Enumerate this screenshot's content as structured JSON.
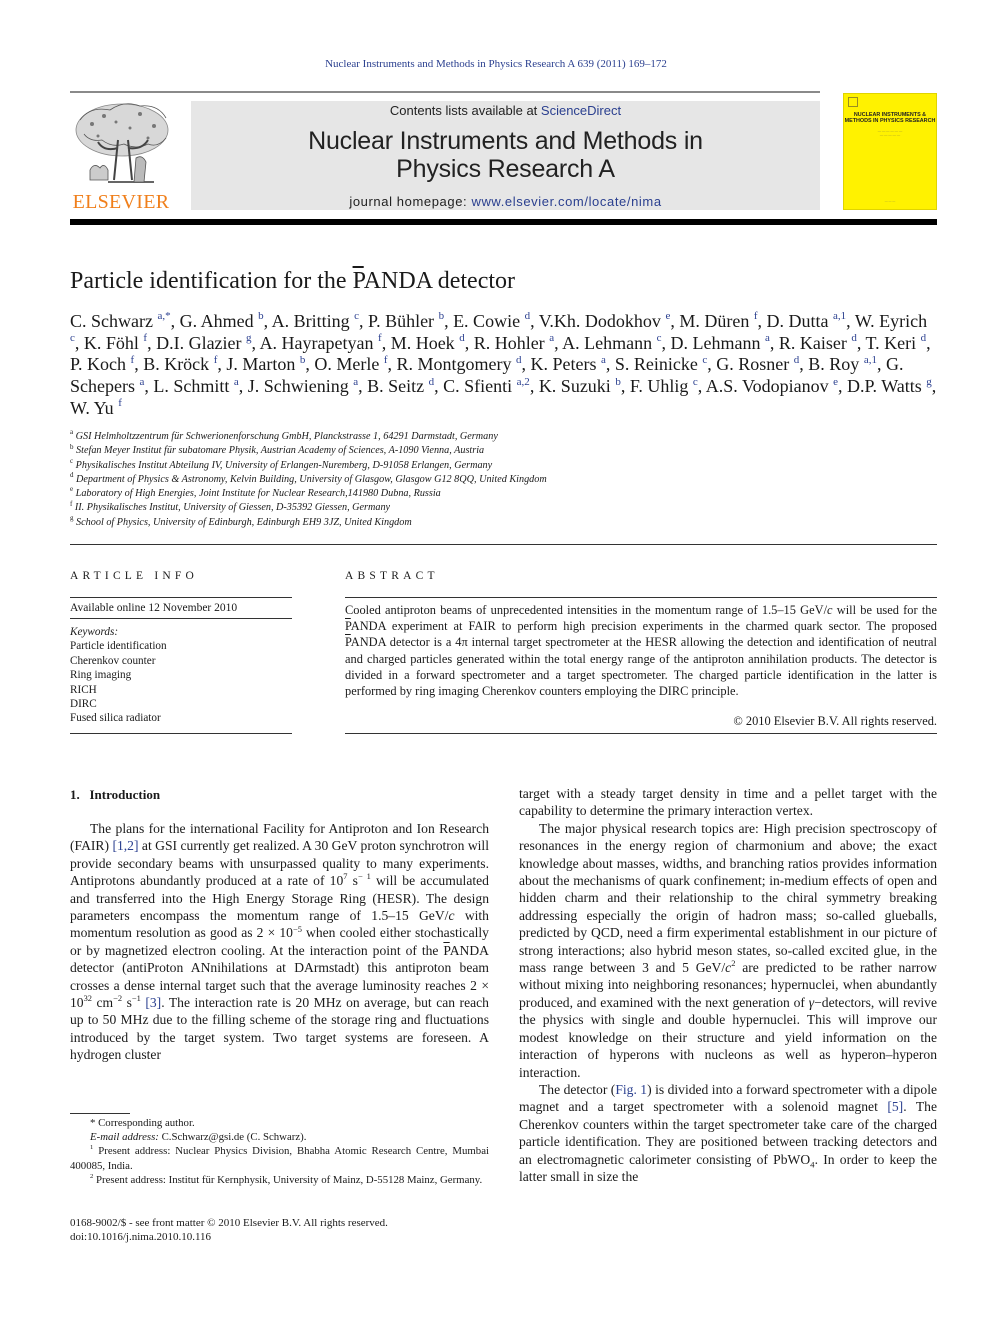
{
  "running_head": "Nuclear Instruments and Methods in Physics Research A 639 (2011) 169–172",
  "masthead": {
    "contents_prefix": "Contents lists available at ",
    "contents_link": "ScienceDirect",
    "journal_line1": "Nuclear Instruments and Methods in",
    "journal_line2": "Physics Research A",
    "homepage_prefix": "journal homepage: ",
    "homepage_link": "www.elsevier.com/locate/nima",
    "publisher_logo_text": "ELSEVIER",
    "cover_title": "NUCLEAR INSTRUMENTS & METHODS IN PHYSICS RESEARCH",
    "colors": {
      "publisher_orange": "#f07f1b",
      "link_blue": "#2a3f8f",
      "cover_yellow": "#fff200",
      "masthead_gray": "#e6e6e6"
    }
  },
  "article": {
    "title_prefix": "Particle identification for the ",
    "title_overlined": "P",
    "title_suffix": "ANDA detector",
    "authors": [
      {
        "name": "C. Schwarz",
        "aff": "a,*"
      },
      {
        "name": "G. Ahmed",
        "aff": "b"
      },
      {
        "name": "A. Britting",
        "aff": "c"
      },
      {
        "name": "P. Bühler",
        "aff": "b"
      },
      {
        "name": "E. Cowie",
        "aff": "d"
      },
      {
        "name": "V.Kh. Dodokhov",
        "aff": "e"
      },
      {
        "name": "M. Düren",
        "aff": "f"
      },
      {
        "name": "D. Dutta",
        "aff": "a,1"
      },
      {
        "name": "W. Eyrich",
        "aff": "c"
      },
      {
        "name": "K. Föhl",
        "aff": "f"
      },
      {
        "name": "D.I. Glazier",
        "aff": "g"
      },
      {
        "name": "A. Hayrapetyan",
        "aff": "f"
      },
      {
        "name": "M. Hoek",
        "aff": "d"
      },
      {
        "name": "R. Hohler",
        "aff": "a"
      },
      {
        "name": "A. Lehmann",
        "aff": "c"
      },
      {
        "name": "D. Lehmann",
        "aff": "a"
      },
      {
        "name": "R. Kaiser",
        "aff": "d"
      },
      {
        "name": "T. Keri",
        "aff": "d"
      },
      {
        "name": "P. Koch",
        "aff": "f"
      },
      {
        "name": "B. Kröck",
        "aff": "f"
      },
      {
        "name": "J. Marton",
        "aff": "b"
      },
      {
        "name": "O. Merle",
        "aff": "f"
      },
      {
        "name": "R. Montgomery",
        "aff": "d"
      },
      {
        "name": "K. Peters",
        "aff": "a"
      },
      {
        "name": "S. Reinicke",
        "aff": "c"
      },
      {
        "name": "G. Rosner",
        "aff": "d"
      },
      {
        "name": "B. Roy",
        "aff": "a,1"
      },
      {
        "name": "G. Schepers",
        "aff": "a"
      },
      {
        "name": "L. Schmitt",
        "aff": "a"
      },
      {
        "name": "J. Schwiening",
        "aff": "a"
      },
      {
        "name": "B. Seitz",
        "aff": "d"
      },
      {
        "name": "C. Sfienti",
        "aff": "a,2"
      },
      {
        "name": "K. Suzuki",
        "aff": "b"
      },
      {
        "name": "F. Uhlig",
        "aff": "c"
      },
      {
        "name": "A.S. Vodopianov",
        "aff": "e"
      },
      {
        "name": "D.P. Watts",
        "aff": "g"
      },
      {
        "name": "W. Yu",
        "aff": "f"
      }
    ],
    "affiliations": [
      {
        "key": "a",
        "text": "GSI Helmholtzzentrum für Schwerionenforschung GmbH, Planckstrasse 1, 64291 Darmstadt, Germany"
      },
      {
        "key": "b",
        "text": "Stefan Meyer Institut für subatomare Physik, Austrian Academy of Sciences, A-1090 Vienna, Austria"
      },
      {
        "key": "c",
        "text": "Physikalisches Institut Abteilung IV, University of Erlangen-Nuremberg, D-91058 Erlangen, Germany"
      },
      {
        "key": "d",
        "text": "Department of Physics & Astronomy, Kelvin Building, University of Glasgow, Glasgow G12 8QQ, United Kingdom"
      },
      {
        "key": "e",
        "text": "Laboratory of High Energies, Joint Institute for Nuclear Research,141980 Dubna, Russia"
      },
      {
        "key": "f",
        "text": "II. Physikalisches Institut, University of Giessen, D-35392 Giessen, Germany"
      },
      {
        "key": "g",
        "text": "School of Physics, University of Edinburgh, Edinburgh EH9 3JZ, United Kingdom"
      }
    ]
  },
  "article_info": {
    "heading": "ARTICLE INFO",
    "available": "Available online 12 November 2010",
    "keywords_label": "Keywords:",
    "keywords": [
      "Particle identification",
      "Cherenkov counter",
      "Ring imaging",
      "RICH",
      "DIRC",
      "Fused silica radiator"
    ]
  },
  "abstract": {
    "heading": "ABSTRACT",
    "text_1": "Cooled antiproton beams of unprecedented intensities in the momentum range of 1.5–15 GeV/",
    "text_1_c": "c",
    "text_2": " will be used for the ",
    "text_2_p": "P",
    "text_3": "ANDA experiment at FAIR to perform high precision experiments in the charmed quark sector. The proposed ",
    "text_3_p": "P",
    "text_4": "ANDA detector is a 4π internal target spectrometer at the HESR allowing the detection and identification of neutral and charged particles generated within the total energy range of the antiproton annihilation products. The detector is divided in a forward spectrometer and a target spectrometer. The charged particle identification in the latter is performed by ring imaging Cherenkov counters employing the DIRC principle.",
    "copyright": "© 2010 Elsevier B.V. All rights reserved."
  },
  "introduction": {
    "heading": "1.   Introduction",
    "p1": {
      "a": "The plans for the international Facility for Antiproton and Ion Research (FAIR) ",
      "ref1": "[1,2]",
      "b": " at GSI currently get realized. A 30 GeV proton synchrotron will provide secondary beams with unsurpassed quality to many experiments. Antiprotons abundantly produced at a rate of 10",
      "sup1": "7",
      "c": " s",
      "sup2": "− 1",
      "d": " will be accumulated and transferred into the High Energy Storage Ring (HESR). The design parameters encompass the momentum range of 1.5–15 GeV/",
      "c_italic": "c",
      "e": " with momentum resolution as good as 2 × 10",
      "sup3": "−5",
      "f": " when cooled either stochastically or by magnetized electron cooling. At the interaction point of the ",
      "pbar": "P",
      "g": "ANDA detector (antiProton ANnihilations at DArmstadt) this antiproton beam crosses a dense internal target such that the average luminosity reaches 2 × 10",
      "sup4": "32",
      "h": " cm",
      "sup5": "−2",
      "i": " s",
      "sup6": "−1",
      "j": " ",
      "ref2": "[3]",
      "k": ". The interaction rate is 20 MHz on average, but can reach up to 50 MHz due to the filling scheme of the storage ring and fluctuations introduced by the target system. Two target systems are foreseen. A hydrogen cluster"
    },
    "right_p0": "target with a steady target density in time and a pellet target with the capability to determine the primary interaction vertex.",
    "right_p1": {
      "a": "The major physical research topics are: High precision spectroscopy of resonances in the energy region of charmonium and above; the exact knowledge about masses, widths, and branching ratios provides information about the mechanisms of quark confinement; in-medium effects of open and hidden charm and their relationship to the chiral symmetry breaking addressing especially the origin of hadron mass; so-called glueballs, predicted by QCD, need a firm experimental establishment in our picture of strong interactions; also hybrid meson states, so-called excited glue, in the mass range between 3 and 5 GeV/",
      "c_italic": "c",
      "sup": "2",
      "b": " are predicted to be rather narrow without mixing into neighboring resonances; hypernuclei, when abundantly produced, and examined with the next generation of ",
      "gamma": "γ",
      "c": "−detectors, will revive the physics with single and double hypernuclei. This will improve our modest knowledge on their structure and yield information on the interaction of hyperons with nucleons as well as hyperon–hyperon interaction."
    },
    "right_p2": {
      "a": "The detector (",
      "fig_ref": "Fig. 1",
      "b": ") is divided into a forward spectrometer with a dipole magnet and a target spectrometer with a solenoid magnet ",
      "ref": "[5]",
      "c": ". The Cherenkov counters within the target spectrometer take care of the charged particle identification. They are positioned between tracking detectors and an electromagnetic calorimeter consisting of PbWO",
      "sub": "4",
      "d": ". In order to keep the latter small in size the"
    }
  },
  "footnotes": {
    "corresponding": "* Corresponding author.",
    "email_label": "E-mail address: ",
    "email": "C.Schwarz@gsi.de (C. Schwarz).",
    "fn1_mark": "1",
    "fn1": " Present address: Nuclear Physics Division, Bhabha Atomic Research Centre, Mumbai 400085, India.",
    "fn2_mark": "2",
    "fn2": " Present address: Institut für Kernphysik, University of Mainz, D-55128 Mainz, Germany."
  },
  "frontmatter": {
    "issn": "0168-9002/$ - see front matter © 2010 Elsevier B.V. All rights reserved.",
    "doi": "doi:10.1016/j.nima.2010.10.116"
  }
}
